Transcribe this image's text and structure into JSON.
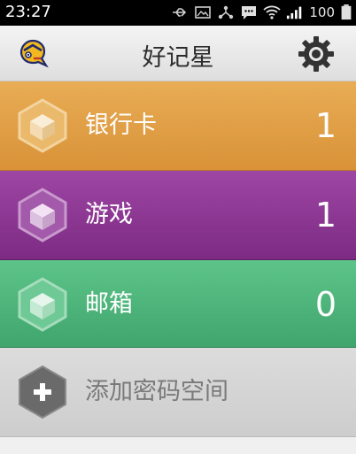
{
  "status_bar": {
    "time": "23:27",
    "battery": "100",
    "icons": [
      "usb-icon",
      "image-icon",
      "share-icon",
      "message-icon",
      "wifi-icon",
      "signal-icon",
      "battery-icon"
    ]
  },
  "header": {
    "title": "好记星",
    "left_icon": "app-logo-icon",
    "right_icon": "gear-icon"
  },
  "spaces": [
    {
      "label": "银行卡",
      "count": "1",
      "color": "#e0a046"
    },
    {
      "label": "游戏",
      "count": "1",
      "color": "#8e3896"
    },
    {
      "label": "邮箱",
      "count": "0",
      "color": "#4db57a"
    }
  ],
  "add_space": {
    "label": "添加密码空间",
    "icon": "plus-icon"
  }
}
